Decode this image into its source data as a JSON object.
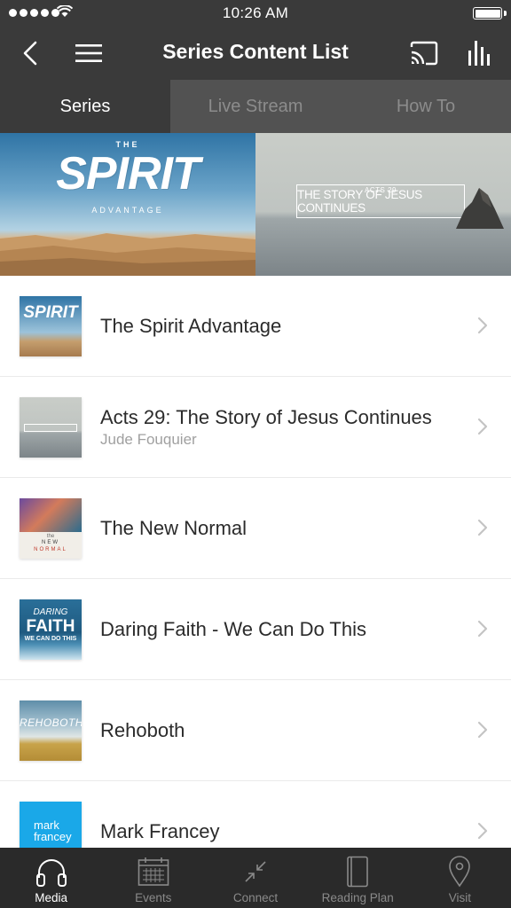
{
  "status_bar": {
    "time": "10:26 AM"
  },
  "nav": {
    "title": "Series Content List"
  },
  "tabs": [
    {
      "label": "Series",
      "active": true
    },
    {
      "label": "Live Stream",
      "active": false
    },
    {
      "label": "How To",
      "active": false
    }
  ],
  "banner": {
    "left": {
      "the": "THE",
      "word": "SPIRIT",
      "sub": "ADVANTAGE"
    },
    "right": {
      "small": "ACTS 29",
      "title": "THE STORY OF JESUS CONTINUES"
    }
  },
  "thumbnails": {
    "spirit": "SPIRIT",
    "newnormal": {
      "the": "the",
      "new": "NEW",
      "normal": "NORMAL"
    },
    "daring": {
      "daring": "DARING",
      "faith": "FAITH",
      "sub": "WE CAN DO THIS"
    },
    "rehoboth": "REHOBOTH",
    "mark": {
      "line1": "mark",
      "line2": "francey"
    }
  },
  "list": [
    {
      "title": "The Spirit Advantage",
      "subtitle": ""
    },
    {
      "title": "Acts 29: The Story of Jesus Continues",
      "subtitle": "Jude Fouquier"
    },
    {
      "title": "The New Normal",
      "subtitle": ""
    },
    {
      "title": "Daring Faith - We Can Do This",
      "subtitle": ""
    },
    {
      "title": "Rehoboth",
      "subtitle": ""
    },
    {
      "title": "Mark Francey",
      "subtitle": ""
    }
  ],
  "bottom_tabs": [
    {
      "label": "Media",
      "icon": "headphones-icon",
      "active": true
    },
    {
      "label": "Events",
      "icon": "calendar-icon",
      "active": false
    },
    {
      "label": "Connect",
      "icon": "connect-arrows-icon",
      "active": false
    },
    {
      "label": "Reading Plan",
      "icon": "book-icon",
      "active": false
    },
    {
      "label": "Visit",
      "icon": "location-pin-icon",
      "active": false
    }
  ],
  "colors": {
    "nav_bg": "#3a3a3a",
    "tab_inactive_bg": "#525252",
    "tab_bar_bg": "#2a2a2a",
    "text_primary": "#2b2b2b",
    "text_secondary": "#a0a0a0"
  }
}
